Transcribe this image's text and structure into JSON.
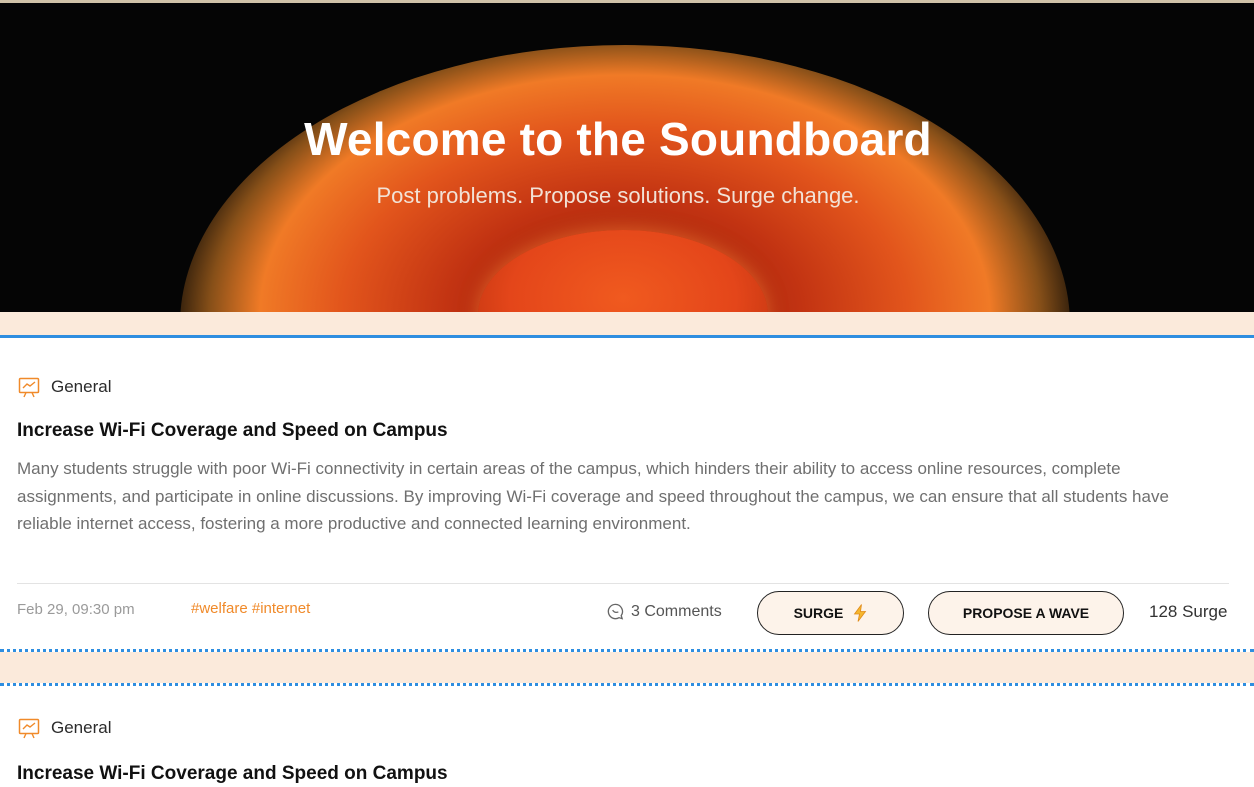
{
  "hero": {
    "title": "Welcome to the Soundboard",
    "subtitle": "Post problems. Propose solutions. Surge change."
  },
  "posts": [
    {
      "category": "General",
      "title": "Increase Wi-Fi Coverage and Speed on Campus",
      "body": "Many students struggle with poor Wi-Fi connectivity in certain areas of the campus, which hinders their ability to access online resources, complete assignments, and participate in online discussions. By improving Wi-Fi coverage and speed throughout the campus, we can ensure that all students have reliable internet access, fostering a more productive and connected learning environment.",
      "date": "Feb 29, 09:30 pm",
      "tags": "#welfare #internet",
      "comments": "3 Comments",
      "surge_label": "SURGE",
      "wave_label": "PROPOSE A WAVE",
      "surge_count": "128 Surge"
    },
    {
      "category": "General",
      "title": "Increase Wi-Fi Coverage and Speed on Campus"
    }
  ],
  "colors": {
    "accent_orange": "#f08a2a",
    "divider_blue": "#2e8ee0",
    "page_bg": "#fbeadb"
  },
  "icons": {
    "category": "presentation-board-icon",
    "comments": "chat-bubble-icon",
    "surge": "lightning-icon"
  }
}
